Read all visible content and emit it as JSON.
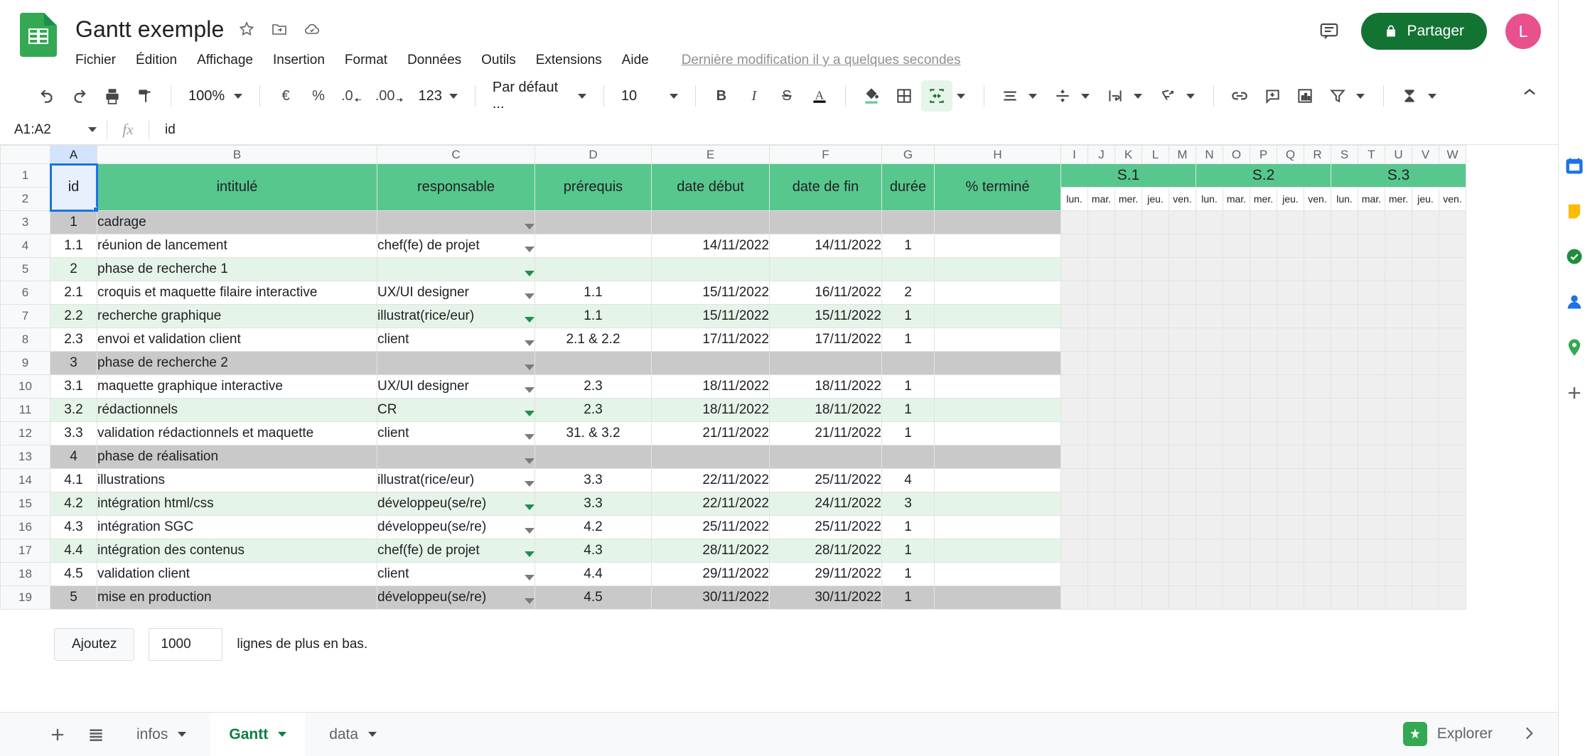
{
  "app": {
    "doc_title": "Gantt exemple",
    "last_edit": "Dernière modification il y a quelques secondes",
    "share_label": "Partager",
    "avatar_initial": "L",
    "accent_green": "#137333",
    "header_green": "#57c78e",
    "alt_row_green": "#e5f4e9",
    "phase_grey": "#c9c9c9"
  },
  "menu": {
    "items": [
      {
        "label": "Fichier"
      },
      {
        "label": "Édition"
      },
      {
        "label": "Affichage"
      },
      {
        "label": "Insertion"
      },
      {
        "label": "Format"
      },
      {
        "label": "Données"
      },
      {
        "label": "Outils"
      },
      {
        "label": "Extensions"
      },
      {
        "label": "Aide"
      }
    ]
  },
  "toolbar": {
    "zoom_value": "100%",
    "currency": "€",
    "percent": "%",
    "dec_decrease": ".0",
    "dec_increase": ".00",
    "number_format": "123",
    "font_value": "Par défaut ...",
    "font_size": "10",
    "bold": "B",
    "italic": "I",
    "strikethrough": "S"
  },
  "formula_bar": {
    "name_box": "A1:A2",
    "fx": "fx",
    "formula": "id"
  },
  "grid": {
    "columns": [
      "A",
      "B",
      "C",
      "D",
      "E",
      "F",
      "G",
      "H",
      "I",
      "J",
      "K",
      "L",
      "M",
      "N",
      "O",
      "P",
      "Q",
      "R",
      "S",
      "T",
      "U",
      "V",
      "W"
    ],
    "headers_row1": [
      "id",
      "intitulé",
      "responsable",
      "prérequis",
      "date début",
      "date de fin",
      "durée",
      "% terminé"
    ],
    "weeks": [
      "S.1",
      "S.2",
      "S.3"
    ],
    "days": [
      "lun.",
      "mar.",
      "mer.",
      "jeu.",
      "ven."
    ],
    "row_numbers": [
      "1",
      "2",
      "3",
      "4",
      "5",
      "6",
      "7",
      "8",
      "9",
      "10",
      "11",
      "12",
      "13",
      "14",
      "15",
      "16",
      "17",
      "18",
      "19"
    ],
    "rows": [
      {
        "n": "3",
        "style": "phase",
        "id": "1",
        "intitule": "cadrage",
        "responsable": "",
        "prerequis": "",
        "debut": "",
        "fin": "",
        "duree": "",
        "pct": ""
      },
      {
        "n": "4",
        "style": "plain",
        "id": "1.1",
        "intitule": "réunion de lancement",
        "responsable": "chef(fe) de projet",
        "prerequis": "",
        "debut": "14/11/2022",
        "fin": "14/11/2022",
        "duree": "1",
        "pct": ""
      },
      {
        "n": "5",
        "style": "alt",
        "id": "2",
        "intitule": "phase de recherche 1",
        "responsable": "",
        "prerequis": "",
        "debut": "",
        "fin": "",
        "duree": "",
        "pct": ""
      },
      {
        "n": "6",
        "style": "plain",
        "id": "2.1",
        "intitule": "croquis et maquette filaire interactive",
        "responsable": "UX/UI designer",
        "prerequis": "1.1",
        "debut": "15/11/2022",
        "fin": "16/11/2022",
        "duree": "2",
        "pct": ""
      },
      {
        "n": "7",
        "style": "alt",
        "id": "2.2",
        "intitule": "recherche graphique",
        "responsable": "illustrat(rice/eur)",
        "prerequis": "1.1",
        "debut": "15/11/2022",
        "fin": "15/11/2022",
        "duree": "1",
        "pct": ""
      },
      {
        "n": "8",
        "style": "plain",
        "id": "2.3",
        "intitule": "envoi et validation client",
        "responsable": "client",
        "prerequis": "2.1 & 2.2",
        "debut": "17/11/2022",
        "fin": "17/11/2022",
        "duree": "1",
        "pct": ""
      },
      {
        "n": "9",
        "style": "phase",
        "id": "3",
        "intitule": "phase de recherche 2",
        "responsable": "",
        "prerequis": "",
        "debut": "",
        "fin": "",
        "duree": "",
        "pct": ""
      },
      {
        "n": "10",
        "style": "plain",
        "id": "3.1",
        "intitule": "maquette graphique interactive",
        "responsable": "UX/UI designer",
        "prerequis": "2.3",
        "debut": "18/11/2022",
        "fin": "18/11/2022",
        "duree": "1",
        "pct": ""
      },
      {
        "n": "11",
        "style": "alt",
        "id": "3.2",
        "intitule": "rédactionnels",
        "responsable": "CR",
        "prerequis": "2.3",
        "debut": "18/11/2022",
        "fin": "18/11/2022",
        "duree": "1",
        "pct": ""
      },
      {
        "n": "12",
        "style": "plain",
        "id": "3.3",
        "intitule": "validation rédactionnels et maquette",
        "responsable": "client",
        "prerequis": "31. & 3.2",
        "debut": "21/11/2022",
        "fin": "21/11/2022",
        "duree": "1",
        "pct": ""
      },
      {
        "n": "13",
        "style": "phase",
        "id": "4",
        "intitule": "phase de réalisation",
        "responsable": "",
        "prerequis": "",
        "debut": "",
        "fin": "",
        "duree": "",
        "pct": ""
      },
      {
        "n": "14",
        "style": "plain",
        "id": "4.1",
        "intitule": "illustrations",
        "responsable": "illustrat(rice/eur)",
        "prerequis": "3.3",
        "debut": "22/11/2022",
        "fin": "25/11/2022",
        "duree": "4",
        "pct": ""
      },
      {
        "n": "15",
        "style": "alt",
        "id": "4.2",
        "intitule": "intégration html/css",
        "responsable": "développeu(se/re)",
        "prerequis": "3.3",
        "debut": "22/11/2022",
        "fin": "24/11/2022",
        "duree": "3",
        "pct": ""
      },
      {
        "n": "16",
        "style": "plain",
        "id": "4.3",
        "intitule": "intégration SGC",
        "responsable": "développeu(se/re)",
        "prerequis": "4.2",
        "debut": "25/11/2022",
        "fin": "25/11/2022",
        "duree": "1",
        "pct": ""
      },
      {
        "n": "17",
        "style": "alt",
        "id": "4.4",
        "intitule": "intégration des contenus",
        "responsable": "chef(fe) de projet",
        "prerequis": "4.3",
        "debut": "28/11/2022",
        "fin": "28/11/2022",
        "duree": "1",
        "pct": ""
      },
      {
        "n": "18",
        "style": "plain",
        "id": "4.5",
        "intitule": "validation client",
        "responsable": "client",
        "prerequis": "4.4",
        "debut": "29/11/2022",
        "fin": "29/11/2022",
        "duree": "1",
        "pct": ""
      },
      {
        "n": "19",
        "style": "phase",
        "id": "5",
        "intitule": "mise en production",
        "responsable": "développeu(se/re)",
        "prerequis": "4.5",
        "debut": "30/11/2022",
        "fin": "30/11/2022",
        "duree": "1",
        "pct": ""
      }
    ]
  },
  "add_rows": {
    "button": "Ajoutez",
    "count": "1000",
    "suffix": "lignes de plus en bas."
  },
  "sheet_tabs": [
    {
      "label": "infos",
      "active": false
    },
    {
      "label": "Gantt",
      "active": true
    },
    {
      "label": "data",
      "active": false
    }
  ],
  "bottom": {
    "explorer": "Explorer"
  }
}
